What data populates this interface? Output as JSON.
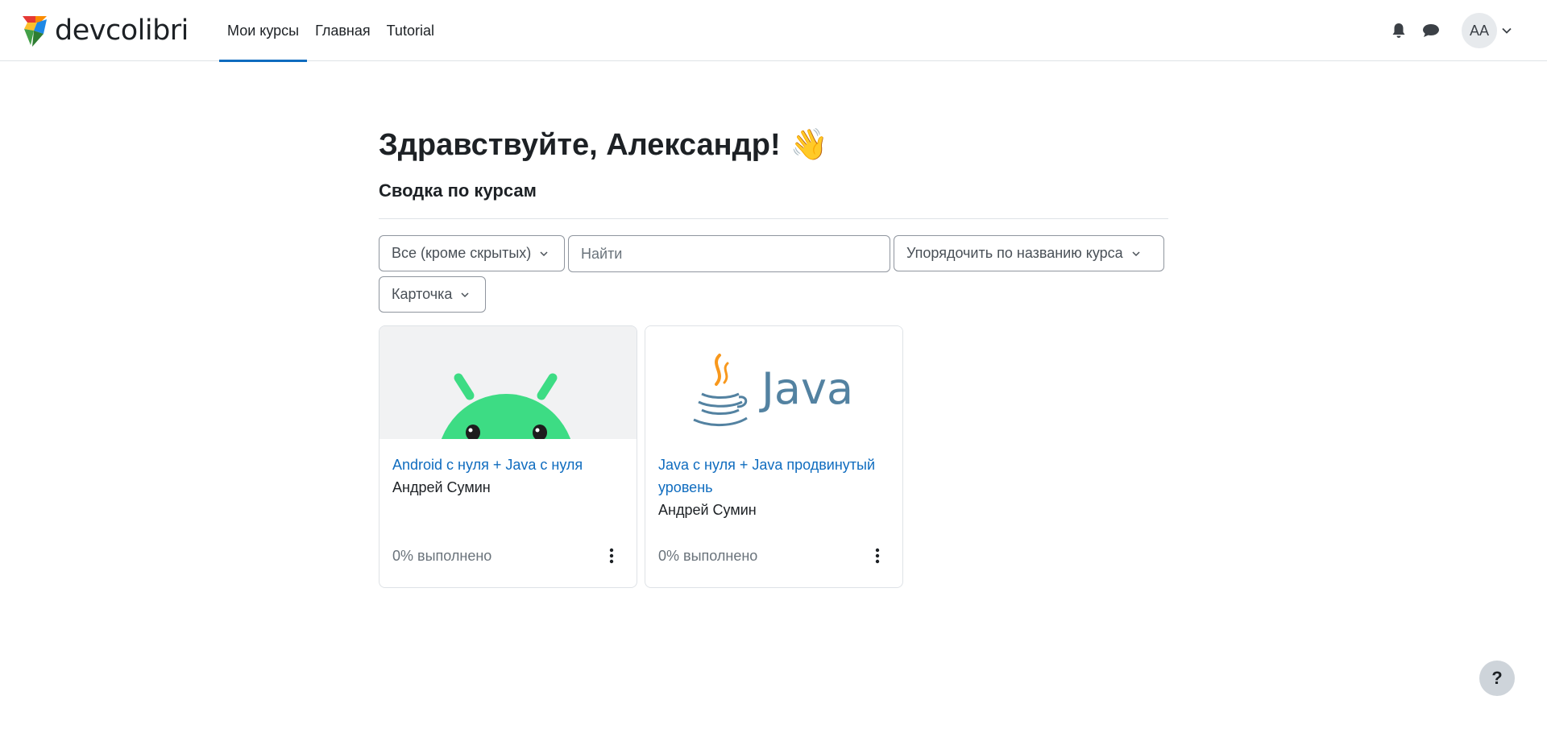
{
  "brand": {
    "name": "devcolibri"
  },
  "nav": {
    "items": [
      {
        "label": "Мои курсы",
        "active": true
      },
      {
        "label": "Главная",
        "active": false
      },
      {
        "label": "Tutorial",
        "active": false
      }
    ]
  },
  "user": {
    "initials": "AA"
  },
  "icons": {
    "notifications": "bell-icon",
    "messages": "chat-bubble-icon",
    "user_menu": "chevron-down-icon",
    "course_menu": "kebab-icon",
    "wave": "waving-hand-icon"
  },
  "page": {
    "greeting": "Здравствуйте, Александр!",
    "wave_emoji": "👋",
    "section_title": "Сводка по курсам"
  },
  "filters": {
    "grouping": "Все (кроме скрытых)",
    "search_placeholder": "Найти",
    "sort": "Упорядочить по названию курса",
    "view": "Карточка"
  },
  "courses": [
    {
      "title": "Android с нуля + Java с нуля",
      "author": "Андрей Сумин",
      "progress_text": "0% выполнено",
      "progress": 0,
      "image": "android-robot"
    },
    {
      "title": "Java с нуля + Java продвинутый уровень",
      "author": "Андрей Сумин",
      "progress_text": "0% выполнено",
      "progress": 0,
      "image": "java-logo",
      "image_text": "Java"
    }
  ],
  "help": {
    "label": "?"
  },
  "colors": {
    "accent": "#0f6cbf",
    "android_green": "#3ddc84",
    "java_blue": "#5382a1",
    "java_orange": "#f8981d"
  }
}
